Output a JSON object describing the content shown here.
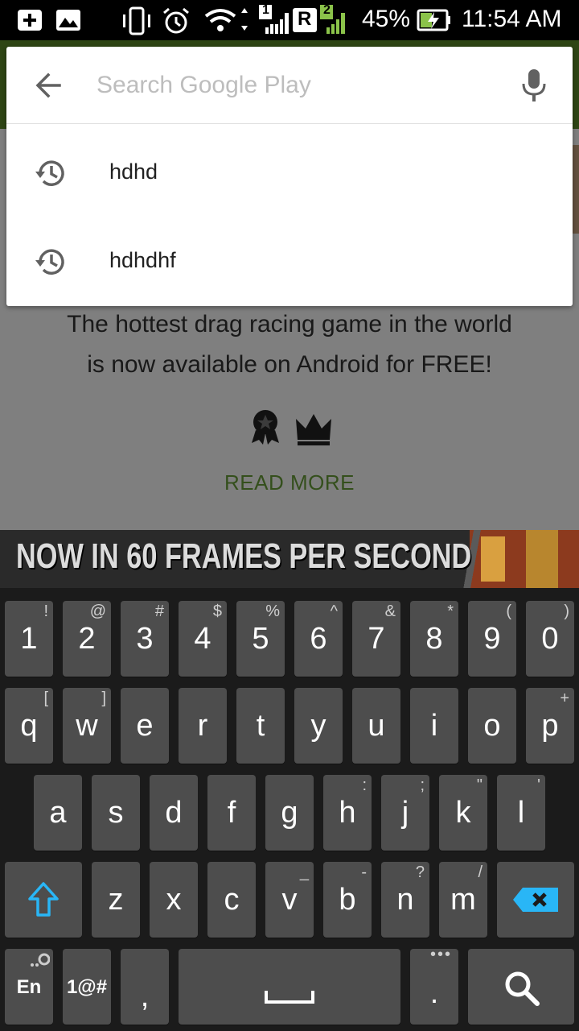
{
  "status_bar": {
    "battery": "45%",
    "time": "11:54 AM",
    "sim1": "1",
    "sim2": "2",
    "roaming": "R",
    "icons": [
      "add-notification-icon",
      "photo-notification-icon",
      "vibrate-icon",
      "alarm-icon",
      "wifi-icon",
      "signal-sim1-icon",
      "roaming-icon",
      "signal-sim2-icon",
      "battery-charging-icon"
    ]
  },
  "search": {
    "placeholder": "Search Google Play",
    "value": "",
    "suggestions": [
      {
        "text": "hdhd",
        "icon": "history-icon"
      },
      {
        "text": "hdhdhf",
        "icon": "history-icon"
      }
    ]
  },
  "background": {
    "description_line1": "The hottest drag racing game in the world",
    "description_line2": "is now available on Android for FREE!",
    "read_more": "READ MORE",
    "banner_text": "NOW IN 60 FRAMES PER SECOND"
  },
  "keyboard": {
    "number_row": [
      {
        "main": "1",
        "hint": "!"
      },
      {
        "main": "2",
        "hint": "@"
      },
      {
        "main": "3",
        "hint": "#"
      },
      {
        "main": "4",
        "hint": "$"
      },
      {
        "main": "5",
        "hint": "%"
      },
      {
        "main": "6",
        "hint": "^"
      },
      {
        "main": "7",
        "hint": "&"
      },
      {
        "main": "8",
        "hint": "*"
      },
      {
        "main": "9",
        "hint": "("
      },
      {
        "main": "0",
        "hint": ")"
      }
    ],
    "row1": [
      {
        "main": "q",
        "hint": "["
      },
      {
        "main": "w",
        "hint": "]"
      },
      {
        "main": "e",
        "hint": ""
      },
      {
        "main": "r",
        "hint": ""
      },
      {
        "main": "t",
        "hint": ""
      },
      {
        "main": "y",
        "hint": ""
      },
      {
        "main": "u",
        "hint": ""
      },
      {
        "main": "i",
        "hint": ""
      },
      {
        "main": "o",
        "hint": ""
      },
      {
        "main": "p",
        "hint": "+"
      }
    ],
    "row2": [
      {
        "main": "a",
        "hint": ""
      },
      {
        "main": "s",
        "hint": ""
      },
      {
        "main": "d",
        "hint": ""
      },
      {
        "main": "f",
        "hint": ""
      },
      {
        "main": "g",
        "hint": ""
      },
      {
        "main": "h",
        "hint": ":"
      },
      {
        "main": "j",
        "hint": ";"
      },
      {
        "main": "k",
        "hint": "\""
      },
      {
        "main": "l",
        "hint": "'"
      }
    ],
    "row3": [
      {
        "main": "z",
        "hint": ""
      },
      {
        "main": "x",
        "hint": ""
      },
      {
        "main": "c",
        "hint": ""
      },
      {
        "main": "v",
        "hint": "_"
      },
      {
        "main": "b",
        "hint": "-"
      },
      {
        "main": "n",
        "hint": "?"
      },
      {
        "main": "m",
        "hint": "/"
      }
    ],
    "lang_label": "En",
    "symbols_label": "1@#",
    "comma": ",",
    "period": ".",
    "accent_color": "#29b6f6"
  },
  "colors": {
    "play_green": "#5c8a29",
    "read_more_green": "#689f38"
  }
}
